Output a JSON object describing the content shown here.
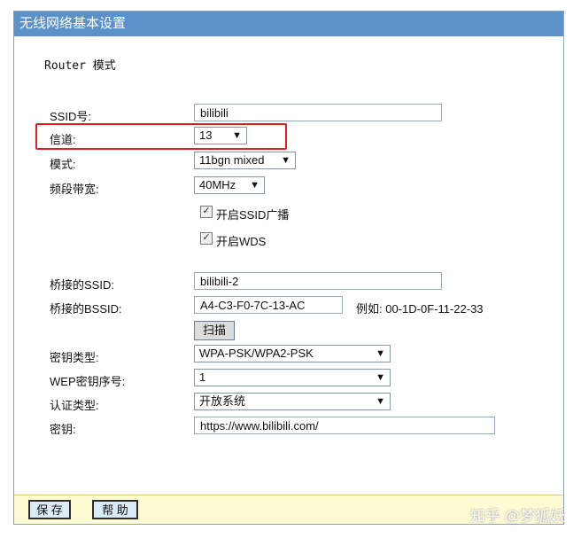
{
  "window": {
    "title": "无线网络基本设置"
  },
  "mode_label": "Router 模式",
  "form": {
    "ssid": {
      "label": "SSID号:",
      "value": "bilibili"
    },
    "channel": {
      "label": "信道:",
      "value": "13"
    },
    "mode": {
      "label": "模式:",
      "value": "11bgn mixed"
    },
    "bandwidth": {
      "label": "频段带宽:",
      "value": "40MHz"
    },
    "ssid_broadcast": {
      "label": "开启SSID广播",
      "checked": true
    },
    "wds": {
      "label": "开启WDS",
      "checked": true
    },
    "bridge_ssid": {
      "label": "桥接的SSID:",
      "value": "bilibili-2"
    },
    "bridge_bssid": {
      "label": "桥接的BSSID:",
      "value": "A4-C3-F0-7C-13-AC",
      "example": "例如: 00-1D-0F-11-22-33"
    },
    "scan_button": "扫描",
    "key_type": {
      "label": "密钥类型:",
      "value": "WPA-PSK/WPA2-PSK"
    },
    "wep_index": {
      "label": "WEP密钥序号:",
      "value": "1"
    },
    "auth_type": {
      "label": "认证类型:",
      "value": "开放系统"
    },
    "key": {
      "label": "密钥:",
      "value": "https://www.bilibili.com/"
    }
  },
  "footer": {
    "save": "保 存",
    "help": "帮 助"
  },
  "watermark": "知乎 @梦狐妖",
  "colors": {
    "titlebar": "#5b90c9",
    "footer": "#fffbd2",
    "highlight": "#e02020"
  }
}
